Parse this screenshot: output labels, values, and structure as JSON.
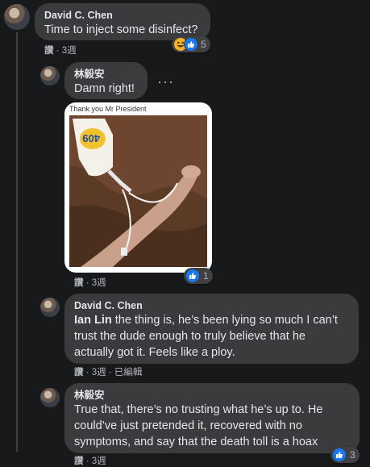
{
  "comments": [
    {
      "author": "David C. Chen",
      "text": "Time to inject some disinfect?",
      "meta_like": "讚",
      "meta_time": " · 3週",
      "reaction_count": "5",
      "reactions": [
        "haha-emoji",
        "like-icon"
      ]
    },
    {
      "author": "林毅安",
      "text": "Damn right!",
      "more_icon": "more-horizontal-icon",
      "photo_caption": "Thank you Mr President",
      "meta_like": "讚",
      "meta_time": " · 3週",
      "reaction_count": "1",
      "reactions": [
        "like-icon"
      ]
    },
    {
      "author": "David C. Chen",
      "mention": "Ian Lin",
      "text_lines": [
        " the thing is, he’s been lying so much I can’t",
        "trust the dude enough to truly believe that he",
        "actually got it. Feels like a ploy."
      ],
      "meta_like": "讚",
      "meta_time": " · 3週 · 已編輯"
    },
    {
      "author": "林毅安",
      "text_lines": [
        "True that, there’s no trusting what he’s up to. He",
        "could’ve just pretended it, recovered with no",
        "symptoms, and say that the death toll is a hoax"
      ],
      "meta_like": "讚",
      "meta_time": " · 3週",
      "reaction_count": "3",
      "reactions": [
        "like-icon"
      ]
    }
  ],
  "colors": {
    "background": "#18191a",
    "bubble": "#3a3b3c",
    "text": "#e4e6eb",
    "meta": "#b0b3b8",
    "like_blue": "#1877f2",
    "haha_yellow": "#f7b125"
  }
}
